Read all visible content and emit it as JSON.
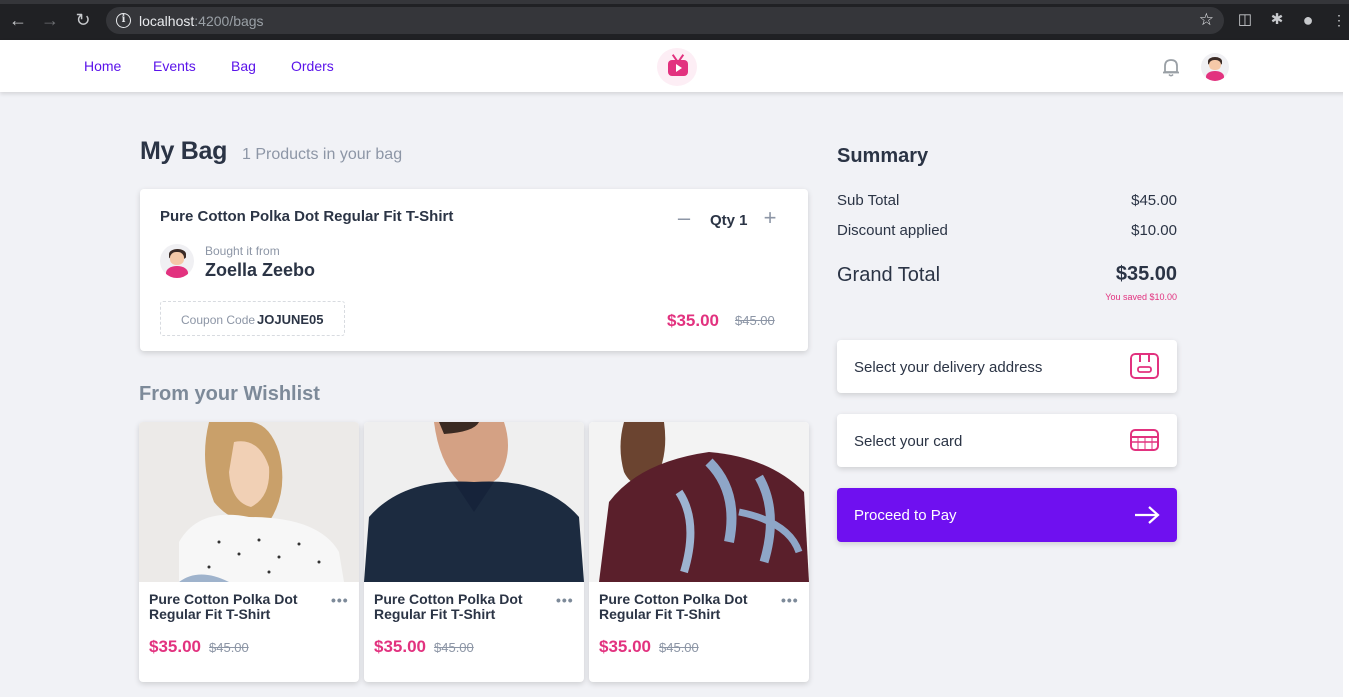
{
  "browser": {
    "url_host": "localhost",
    "url_port_path": ":4200/bags"
  },
  "header": {
    "nav": [
      {
        "label": "Home"
      },
      {
        "label": "Events"
      },
      {
        "label": "Bag"
      },
      {
        "label": "Orders"
      }
    ]
  },
  "page": {
    "title": "My Bag",
    "subtitle": "1 Products in your bag"
  },
  "bag_item": {
    "name": "Pure Cotton Polka Dot Regular Fit T-Shirt",
    "qty_label": "Qty 1",
    "bought_from_label": "Bought it from",
    "seller": "Zoella Zeebo",
    "coupon_label": "Coupon Code",
    "coupon_code": "JOJUNE05",
    "price": "$35.00",
    "original_price": "$45.00"
  },
  "wishlist": {
    "title": "From your Wishlist",
    "items": [
      {
        "name": "Pure Cotton Polka Dot Regular Fit T-Shirt",
        "price": "$35.00",
        "original_price": "$45.00"
      },
      {
        "name": "Pure Cotton Polka Dot Regular Fit T-Shirt",
        "price": "$35.00",
        "original_price": "$45.00"
      },
      {
        "name": "Pure Cotton Polka Dot Regular Fit T-Shirt",
        "price": "$35.00",
        "original_price": "$45.00"
      }
    ]
  },
  "summary": {
    "title": "Summary",
    "subtotal_label": "Sub Total",
    "subtotal": "$45.00",
    "discount_label": "Discount applied",
    "discount": "$10.00",
    "grand_total_label": "Grand Total",
    "grand_total": "$35.00",
    "saved_text": "You saved $10.00",
    "address_label": "Select your delivery address",
    "card_label": "Select your card",
    "pay_label": "Proceed to Pay"
  },
  "colors": {
    "accent": "#6f10f0",
    "pink": "#e2327f",
    "nav_link": "#5b14ea",
    "background": "#f1f2f6"
  },
  "icons": [
    "back-arrow-icon",
    "forward-arrow-icon",
    "reload-icon",
    "info-icon",
    "star-icon",
    "extension-icon",
    "puzzle-icon",
    "profile-icon",
    "menu-icon",
    "tv-logo-icon",
    "bell-icon",
    "minus-icon",
    "plus-icon",
    "more-icon",
    "address-box-icon",
    "credit-card-icon",
    "arrow-right-icon"
  ]
}
